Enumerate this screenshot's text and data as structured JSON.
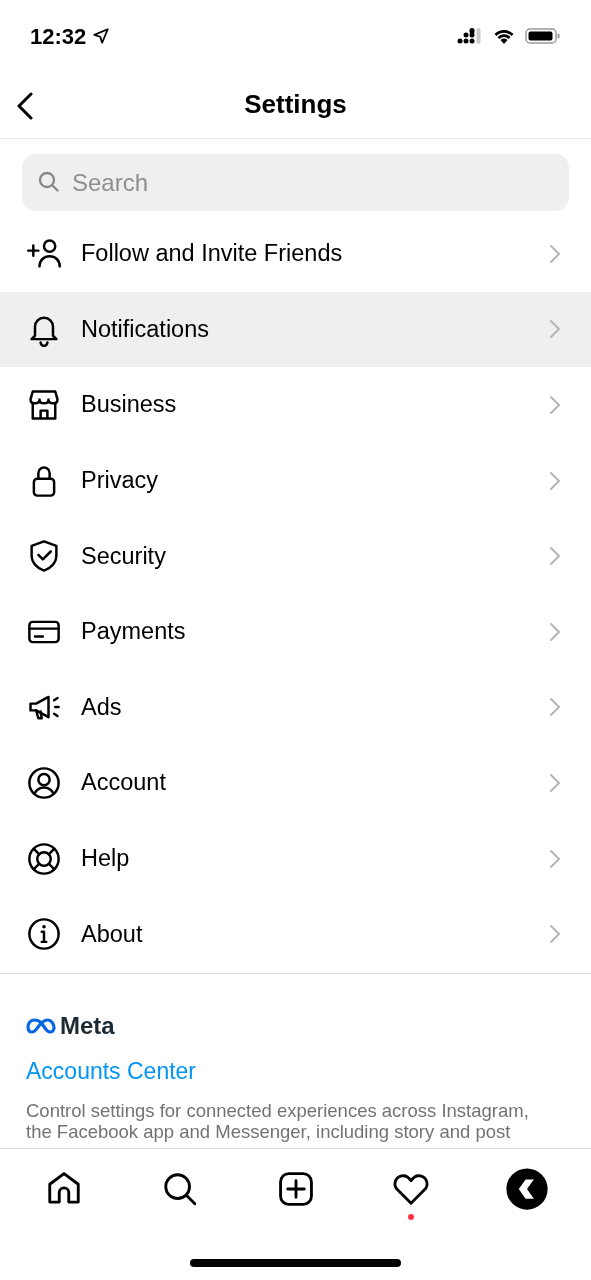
{
  "status_bar": {
    "time": "12:32"
  },
  "header": {
    "title": "Settings"
  },
  "search": {
    "placeholder": "Search"
  },
  "menu": [
    {
      "label": "Follow and Invite Friends",
      "selected": false
    },
    {
      "label": "Notifications",
      "selected": true
    },
    {
      "label": "Business",
      "selected": false
    },
    {
      "label": "Privacy",
      "selected": false
    },
    {
      "label": "Security",
      "selected": false
    },
    {
      "label": "Payments",
      "selected": false
    },
    {
      "label": "Ads",
      "selected": false
    },
    {
      "label": "Account",
      "selected": false
    },
    {
      "label": "Help",
      "selected": false
    },
    {
      "label": "About",
      "selected": false
    }
  ],
  "meta": {
    "brand": "Meta",
    "link": "Accounts Center",
    "description": "Control settings for connected experiences across Instagram, the Facebook app and Messenger, including story and post"
  },
  "tab_bar": [
    {
      "kind": "home"
    },
    {
      "kind": "search"
    },
    {
      "kind": "create"
    },
    {
      "kind": "activity",
      "badge": true
    },
    {
      "kind": "profile"
    }
  ]
}
